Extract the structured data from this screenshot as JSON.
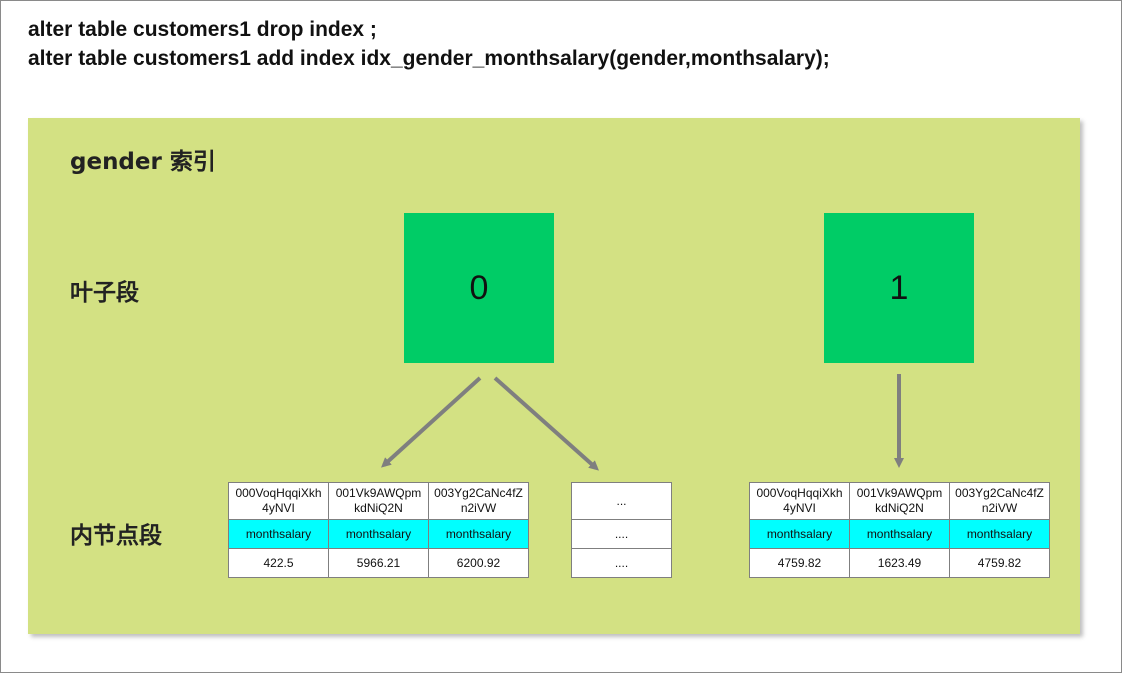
{
  "sql_lines": [
    "alter table customers1 drop index ;",
    "alter table customers1 add index idx_gender_monthsalary(gender,monthsalary);"
  ],
  "panel_title": "gender 索引",
  "row_labels": {
    "leaf": "叶子段",
    "internal": "内节点段"
  },
  "leaf_nodes": [
    "0",
    "1"
  ],
  "node_left": {
    "keys": [
      "000VoqHqqiXkh4yNVI",
      "001Vk9AWQpmkdNiQ2N",
      "003Yg2CaNc4fZn2iVW"
    ],
    "keys_line1": [
      "000VoqHqqiXkh",
      "001Vk9AWQpm",
      "003Yg2CaNc4fZ"
    ],
    "keys_line2": [
      "4yNVI",
      "kdNiQ2N",
      "n2iVW"
    ],
    "field": [
      "monthsalary",
      "monthsalary",
      "monthsalary"
    ],
    "values": [
      "422.5",
      "5966.21",
      "6200.92"
    ]
  },
  "node_ellipsis": [
    "...",
    "....",
    "...."
  ],
  "node_right": {
    "keys_line1": [
      "000VoqHqqiXkh",
      "001Vk9AWQpm",
      "003Yg2CaNc4fZ"
    ],
    "keys_line2": [
      "4yNVI",
      "kdNiQ2N",
      "n2iVW"
    ],
    "field": [
      "monthsalary",
      "monthsalary",
      "monthsalary"
    ],
    "values": [
      "4759.82",
      "1623.49",
      "4759.82"
    ]
  },
  "colors": {
    "panel": "#d3e183",
    "leaf": "#00cc66",
    "field_row": "#00ffff",
    "arrow": "#7f7f7f"
  }
}
